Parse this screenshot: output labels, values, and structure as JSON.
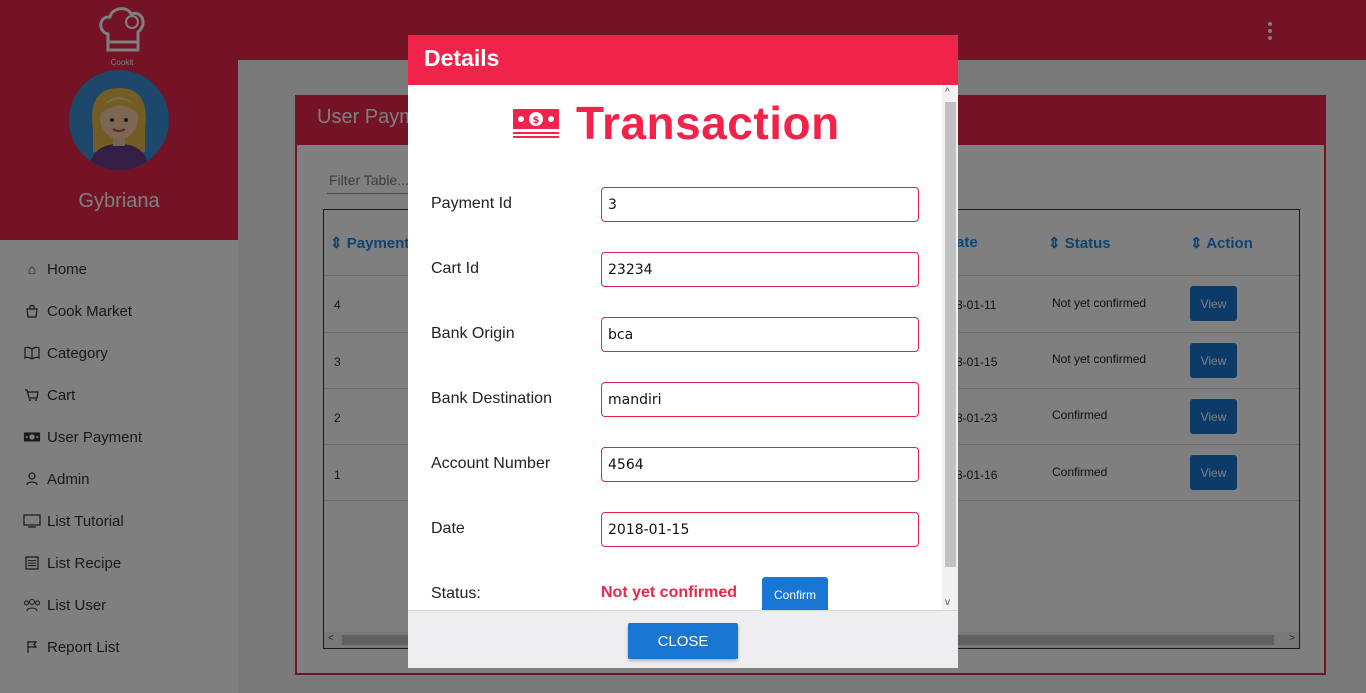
{
  "app": {
    "logo_text": "Cookit",
    "user_name": "Gybriana",
    "colors": {
      "accent": "#f0234b",
      "primary_button": "#1976d2"
    }
  },
  "sidebar": {
    "items": [
      {
        "label": "Home",
        "icon": "home-icon"
      },
      {
        "label": "Cook Market",
        "icon": "shopping-bag-icon"
      },
      {
        "label": "Category",
        "icon": "book-icon"
      },
      {
        "label": "Cart",
        "icon": "cart-icon"
      },
      {
        "label": "User Payment",
        "icon": "money-icon"
      },
      {
        "label": "Admin",
        "icon": "user-icon"
      },
      {
        "label": "List Tutorial",
        "icon": "monitor-icon"
      },
      {
        "label": "List Recipe",
        "icon": "list-icon"
      },
      {
        "label": "List User",
        "icon": "users-icon"
      },
      {
        "label": "Report List",
        "icon": "flag-icon"
      }
    ]
  },
  "panel": {
    "title": "User Paym",
    "filter_placeholder": "Filter Table...",
    "columns": [
      "Payment",
      "ate",
      "Status",
      "Action"
    ],
    "rows": [
      {
        "id": "4",
        "date": "8-01-11",
        "status": "Not yet confirmed",
        "action": "View"
      },
      {
        "id": "3",
        "date": "8-01-15",
        "status": "Not yet confirmed",
        "action": "View"
      },
      {
        "id": "2",
        "date": "8-01-23",
        "status": "Confirmed",
        "action": "View"
      },
      {
        "id": "1",
        "date": "8-01-16",
        "status": "Confirmed",
        "action": "View"
      }
    ]
  },
  "modal": {
    "title": "Details",
    "heading": "Transaction",
    "fields": [
      {
        "label": "Payment Id",
        "value": "3"
      },
      {
        "label": "Cart Id",
        "value": "23234"
      },
      {
        "label": "Bank Origin",
        "value": "bca"
      },
      {
        "label": "Bank Destination",
        "value": "mandiri"
      },
      {
        "label": "Account Number",
        "value": "4564"
      },
      {
        "label": "Date",
        "value": "2018-01-15"
      }
    ],
    "status_label": "Status:",
    "status_value": "Not yet confirmed",
    "confirm_label": "Confirm",
    "close_label": "CLOSE"
  }
}
